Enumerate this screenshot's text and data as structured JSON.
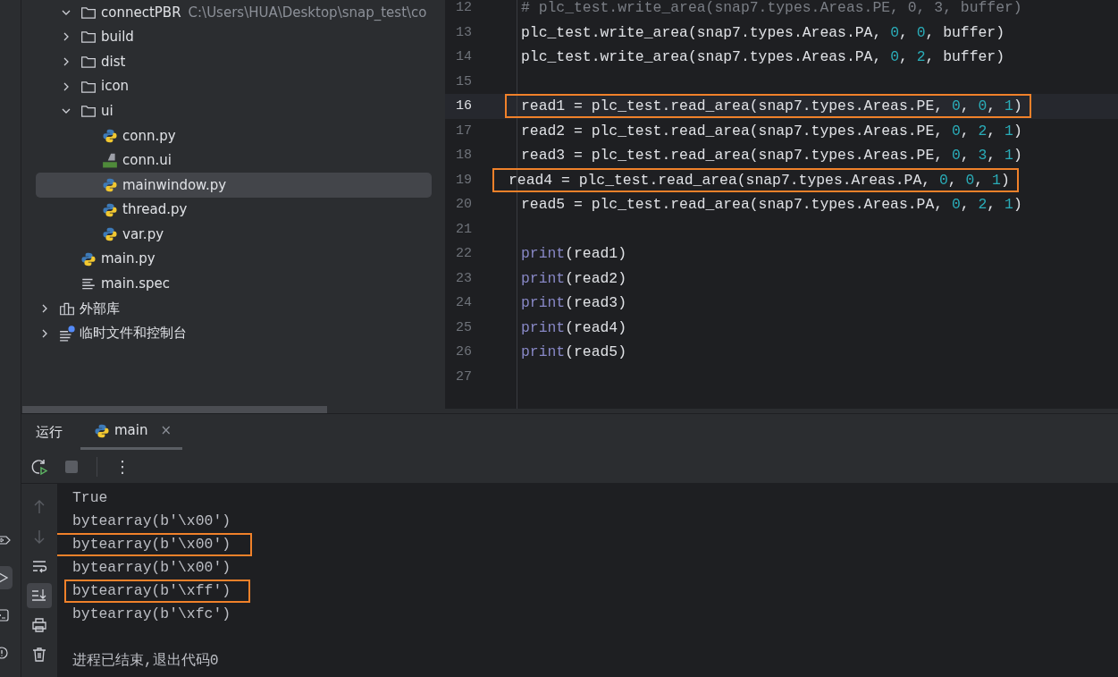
{
  "project_tree": [
    {
      "label": "connectPBR",
      "path": "C:\\Users\\HUA\\Desktop\\snap_test\\co",
      "kind": "folder",
      "nested": true,
      "expanded": true,
      "selected": false,
      "children": [
        {
          "label": "build",
          "kind": "folder",
          "expanded": false,
          "selected": false
        },
        {
          "label": "dist",
          "kind": "folder",
          "expanded": false,
          "selected": false
        },
        {
          "label": "icon",
          "kind": "folder",
          "expanded": false,
          "selected": false
        },
        {
          "label": "ui",
          "kind": "folder",
          "expanded": true,
          "selected": false,
          "children": [
            {
              "label": "conn.py",
              "kind": "python",
              "selected": false
            },
            {
              "label": "conn.ui",
              "kind": "qt",
              "selected": false
            },
            {
              "label": "mainwindow.py",
              "kind": "python",
              "selected": true
            },
            {
              "label": "thread.py",
              "kind": "python",
              "selected": false
            },
            {
              "label": "var.py",
              "kind": "python",
              "selected": false
            }
          ]
        },
        {
          "label": "main.py",
          "kind": "python",
          "selected": false
        },
        {
          "label": "main.spec",
          "kind": "text",
          "selected": false
        }
      ]
    },
    {
      "label": "外部库",
      "kind": "library",
      "expanded": false,
      "selected": false
    },
    {
      "label": "临时文件和控制台",
      "kind": "scratch",
      "expanded": false,
      "selected": false
    }
  ],
  "code_lines": [
    {
      "number": "12",
      "current": false,
      "highlighted": false,
      "tokens": [
        {
          "text": "# plc_test.write_area(snap7.types.Areas.PE, 0, 3, buffer)",
          "kind": "comment"
        }
      ]
    },
    {
      "number": "13",
      "current": false,
      "highlighted": false,
      "tokens": [
        {
          "text": "plc_test.write_area(snap7.types.Areas.PA, ",
          "kind": "plain"
        },
        {
          "text": "0",
          "kind": "number"
        },
        {
          "text": ", ",
          "kind": "plain"
        },
        {
          "text": "0",
          "kind": "number"
        },
        {
          "text": ", buffer)",
          "kind": "plain"
        }
      ]
    },
    {
      "number": "14",
      "current": false,
      "highlighted": false,
      "tokens": [
        {
          "text": "plc_test.write_area(snap7.types.Areas.PA, ",
          "kind": "plain"
        },
        {
          "text": "0",
          "kind": "number"
        },
        {
          "text": ", ",
          "kind": "plain"
        },
        {
          "text": "2",
          "kind": "number"
        },
        {
          "text": ", buffer)",
          "kind": "plain"
        }
      ]
    },
    {
      "number": "15",
      "current": false
    },
    {
      "number": "16",
      "current": true,
      "highlighted": true,
      "tokens": [
        {
          "text": "read1 = plc_test.read_area(snap7.types.Areas.PE, ",
          "kind": "plain"
        },
        {
          "text": "0",
          "kind": "number"
        },
        {
          "text": ", ",
          "kind": "plain"
        },
        {
          "text": "0",
          "kind": "number"
        },
        {
          "text": ", ",
          "kind": "plain"
        },
        {
          "text": "1",
          "kind": "number"
        },
        {
          "text": ")",
          "kind": "plain"
        }
      ]
    },
    {
      "number": "17",
      "current": false,
      "highlighted": false,
      "tokens": [
        {
          "text": "read2 = plc_test.read_area(snap7.types.Areas.PE, ",
          "kind": "plain"
        },
        {
          "text": "0",
          "kind": "number"
        },
        {
          "text": ", ",
          "kind": "plain"
        },
        {
          "text": "2",
          "kind": "number"
        },
        {
          "text": ", ",
          "kind": "plain"
        },
        {
          "text": "1",
          "kind": "number"
        },
        {
          "text": ")",
          "kind": "plain"
        }
      ]
    },
    {
      "number": "18",
      "current": false,
      "highlighted": false,
      "tokens": [
        {
          "text": "read3 = plc_test.read_area(snap7.types.Areas.PE, ",
          "kind": "plain"
        },
        {
          "text": "0",
          "kind": "number"
        },
        {
          "text": ", ",
          "kind": "plain"
        },
        {
          "text": "3",
          "kind": "number"
        },
        {
          "text": ", ",
          "kind": "plain"
        },
        {
          "text": "1",
          "kind": "number"
        },
        {
          "text": ")",
          "kind": "plain"
        }
      ]
    },
    {
      "number": "19",
      "current": false,
      "highlighted": true,
      "tokens": [
        {
          "text": "read4 = plc_test.read_area(snap7.types.Areas.PA, ",
          "kind": "plain"
        },
        {
          "text": "0",
          "kind": "number"
        },
        {
          "text": ", ",
          "kind": "plain"
        },
        {
          "text": "0",
          "kind": "number"
        },
        {
          "text": ", ",
          "kind": "plain"
        },
        {
          "text": "1",
          "kind": "number"
        },
        {
          "text": ")",
          "kind": "plain"
        }
      ]
    },
    {
      "number": "20",
      "current": false,
      "highlighted": false,
      "tokens": [
        {
          "text": "read5 = plc_test.read_area(snap7.types.Areas.PA, ",
          "kind": "plain"
        },
        {
          "text": "0",
          "kind": "number"
        },
        {
          "text": ", ",
          "kind": "plain"
        },
        {
          "text": "2",
          "kind": "number"
        },
        {
          "text": ", ",
          "kind": "plain"
        },
        {
          "text": "1",
          "kind": "number"
        },
        {
          "text": ")",
          "kind": "plain"
        }
      ]
    },
    {
      "number": "21",
      "current": false
    },
    {
      "number": "22",
      "current": false,
      "highlighted": false,
      "tokens": [
        {
          "text": "print",
          "kind": "keyword"
        },
        {
          "text": "(read1)",
          "kind": "plain"
        }
      ]
    },
    {
      "number": "23",
      "current": false,
      "highlighted": false,
      "tokens": [
        {
          "text": "print",
          "kind": "keyword"
        },
        {
          "text": "(read2)",
          "kind": "plain"
        }
      ]
    },
    {
      "number": "24",
      "current": false,
      "highlighted": false,
      "tokens": [
        {
          "text": "print",
          "kind": "keyword"
        },
        {
          "text": "(read3)",
          "kind": "plain"
        }
      ]
    },
    {
      "number": "25",
      "current": false,
      "highlighted": false,
      "tokens": [
        {
          "text": "print",
          "kind": "keyword"
        },
        {
          "text": "(read4)",
          "kind": "plain"
        }
      ]
    },
    {
      "number": "26",
      "current": false,
      "highlighted": false,
      "tokens": [
        {
          "text": "print",
          "kind": "keyword"
        },
        {
          "text": "(read5)",
          "kind": "plain"
        }
      ]
    },
    {
      "number": "27",
      "current": false
    }
  ],
  "run_panel": {
    "title": "运行",
    "tabs": [
      {
        "label": "main",
        "selected": true,
        "close": "×"
      }
    ],
    "more": "⋮"
  },
  "console_lines": [
    {
      "kind": "output",
      "text": "True",
      "highlighted": false
    },
    {
      "kind": "output",
      "text": "bytearray(b'\\x00')",
      "highlighted": false
    },
    {
      "kind": "output",
      "text": "bytearray(b'\\x00')",
      "highlighted": true
    },
    {
      "kind": "output",
      "text": "bytearray(b'\\x00')",
      "highlighted": false
    },
    {
      "kind": "output",
      "text": "bytearray(b'\\xff')",
      "highlighted": true
    },
    {
      "kind": "output",
      "text": "bytearray(b'\\xfc')",
      "highlighted": false
    },
    {
      "kind": "status",
      "text": "进程已结束,退出代码0",
      "highlighted": false
    }
  ]
}
